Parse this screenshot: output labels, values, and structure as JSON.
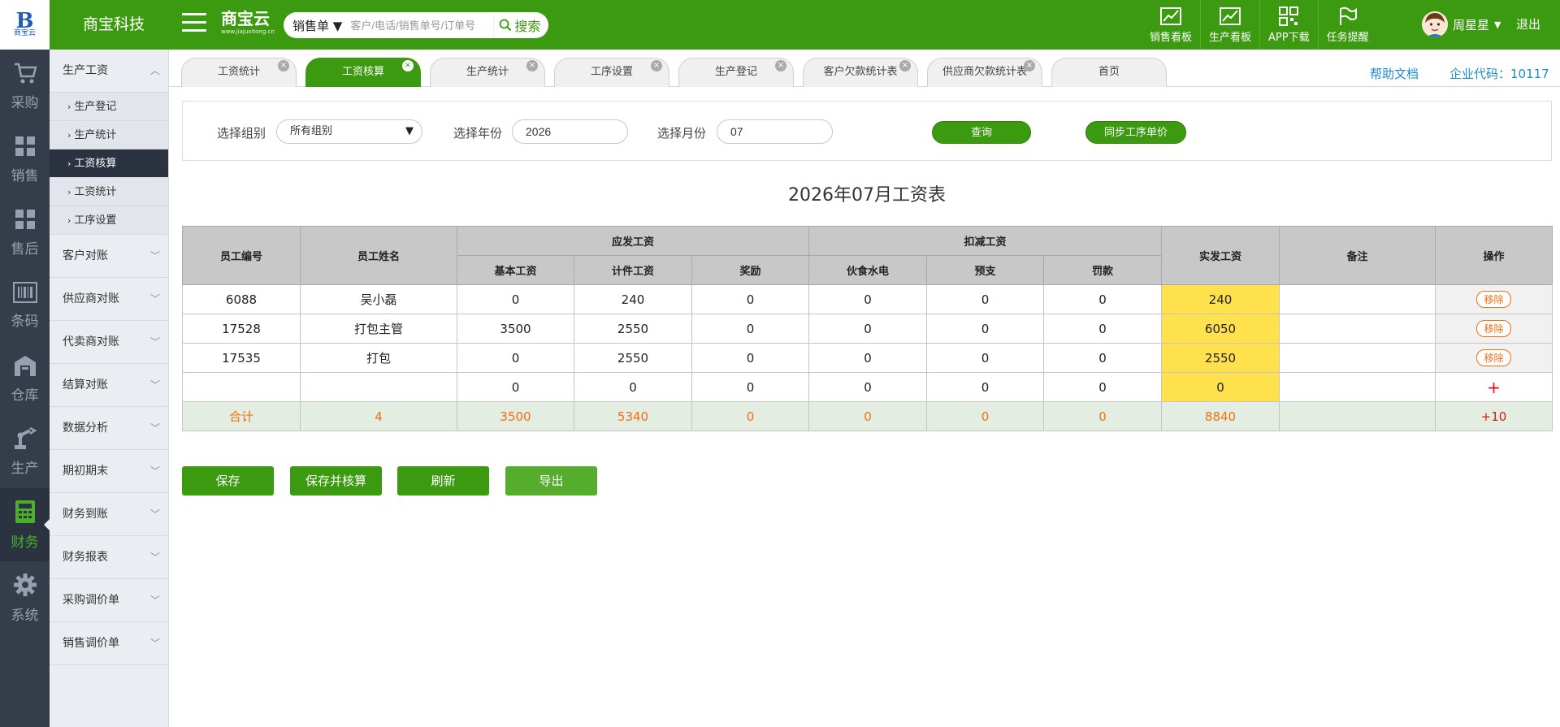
{
  "brand_logo": {
    "mark": "B",
    "text": "商宝云"
  },
  "company_name": "商宝科技",
  "product": {
    "name": "商宝云",
    "site": "www.jiajuxitong.cn"
  },
  "search": {
    "type": "销售单",
    "placeholder": "客户/电话/销售单号/订单号",
    "button": "搜索"
  },
  "top_nav": [
    {
      "label": "销售看板",
      "icon": "trend-chart-icon"
    },
    {
      "label": "生产看板",
      "icon": "trend-chart-icon"
    },
    {
      "label": "APP下载",
      "icon": "qr-code-icon"
    },
    {
      "label": "任务提醒",
      "icon": "flag-icon"
    }
  ],
  "user": {
    "name": "周星星",
    "logout": "退出"
  },
  "side_nav": [
    {
      "label": "采购",
      "icon": "cart-icon"
    },
    {
      "label": "销售",
      "icon": "grid-icon"
    },
    {
      "label": "售后",
      "icon": "grid-icon"
    },
    {
      "label": "条码",
      "icon": "barcode-icon"
    },
    {
      "label": "仓库",
      "icon": "warehouse-icon"
    },
    {
      "label": "生产",
      "icon": "robot-arm-icon"
    },
    {
      "label": "财务",
      "icon": "calculator-icon",
      "active": true
    },
    {
      "label": "系统",
      "icon": "gear-icon"
    }
  ],
  "sub_menu": {
    "open_group": "生产工资",
    "items": [
      "生产登记",
      "生产统计",
      "工资核算",
      "工资统计",
      "工序设置"
    ],
    "active_item": "工资核算",
    "groups": [
      "客户对账",
      "供应商对账",
      "代卖商对账",
      "结算对账",
      "数据分析",
      "期初期末",
      "财务到账",
      "财务报表",
      "采购调价单",
      "销售调价单"
    ]
  },
  "tabs": [
    {
      "label": "工资统计"
    },
    {
      "label": "工资核算",
      "active": true
    },
    {
      "label": "生产统计"
    },
    {
      "label": "工序设置"
    },
    {
      "label": "生产登记"
    },
    {
      "label": "客户欠款统计表"
    },
    {
      "label": "供应商欠款统计表"
    },
    {
      "label": "首页"
    }
  ],
  "help_link": "帮助文档",
  "company_code": "企业代码：10117",
  "filters": {
    "group_label": "选择组别",
    "group_value": "所有组别",
    "year_label": "选择年份",
    "year_value": "2026",
    "month_label": "选择月份",
    "month_value": "07",
    "query_button": "查询",
    "sync_button": "同步工序单价"
  },
  "report_title": "2026年07月工资表",
  "table": {
    "headers": {
      "emp_id": "员工编号",
      "emp_name": "员工姓名",
      "payable": "应发工资",
      "deduction": "扣减工资",
      "paid": "实发工资",
      "note": "备注",
      "action": "操作",
      "basic": "基本工资",
      "piece": "计件工资",
      "bonus": "奖励",
      "meals": "伙食水电",
      "advance": "预支",
      "fine": "罚款"
    },
    "rows": [
      {
        "id": "6088",
        "name": "吴小磊",
        "basic": "0",
        "piece": "240",
        "bonus": "0",
        "meals": "0",
        "advance": "0",
        "fine": "0",
        "paid": "240",
        "note": "",
        "action": "移除"
      },
      {
        "id": "17528",
        "name": "打包主管",
        "basic": "3500",
        "piece": "2550",
        "bonus": "0",
        "meals": "0",
        "advance": "0",
        "fine": "0",
        "paid": "6050",
        "note": "",
        "action": "移除"
      },
      {
        "id": "17535",
        "name": "打包",
        "basic": "0",
        "piece": "2550",
        "bonus": "0",
        "meals": "0",
        "advance": "0",
        "fine": "0",
        "paid": "2550",
        "note": "",
        "action": "移除"
      },
      {
        "id": "",
        "name": "",
        "basic": "0",
        "piece": "0",
        "bonus": "0",
        "meals": "0",
        "advance": "0",
        "fine": "0",
        "paid": "0",
        "note": "",
        "action": "+"
      }
    ],
    "total": {
      "label": "合计",
      "count": "4",
      "basic": "3500",
      "piece": "5340",
      "bonus": "0",
      "meals": "0",
      "advance": "0",
      "fine": "0",
      "paid": "8840",
      "note": "",
      "action": "+10"
    }
  },
  "actions": [
    "保存",
    "保存并核算",
    "刷新",
    "导出"
  ]
}
